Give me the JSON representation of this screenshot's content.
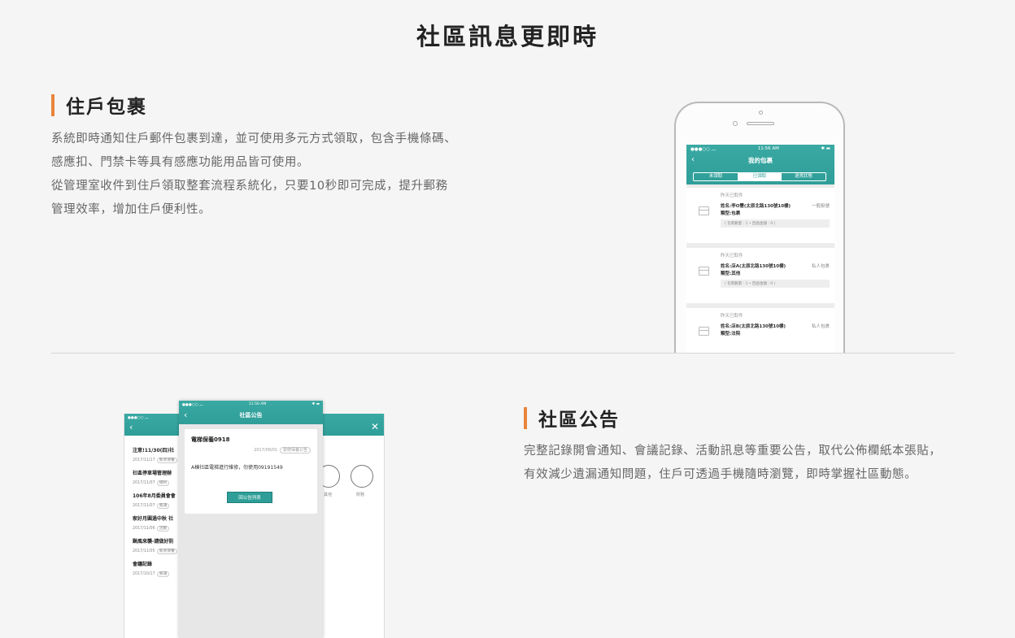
{
  "page_title": "社區訊息更即時",
  "section1": {
    "title": "住戶包裹",
    "paragraphs": [
      "系統即時通知住戶郵件包裹到達，並可使用多元方式領取，包含手機條碼、感應扣、門禁卡等具有感應功能用品皆可使用。",
      "從管理室收件到住戶領取整套流程系統化，只要10秒即可完成，提升郵務管理效率，增加住戶便利性。"
    ],
    "phone": {
      "status_time": "11:56 AM",
      "screen_title": "我的包裹",
      "tabs": [
        "未領取",
        "已領取",
        "退貨狀態"
      ],
      "cards": [
        {
          "when": "昨天已取件",
          "name": "姓名:李O豐(太原北路130號10樓)",
          "tag": "一般掛號",
          "type": "類型:包裹",
          "meta": "( 包裹數量 : 1 • 回函金額 : 0 )"
        },
        {
          "when": "昨天已取件",
          "name": "姓名:店A(太原北路130號10樓)",
          "tag": "私人包裹",
          "type": "類型:其他",
          "meta": "( 包裹數量 : 1 • 回函金額 : 0 )"
        },
        {
          "when": "昨天已取件",
          "name": "姓名:店B(太原北路130號10樓)",
          "tag": "私人包裹",
          "type": "類型:法院",
          "meta": ""
        }
      ]
    }
  },
  "section2": {
    "title": "社區公告",
    "paragraphs": [
      "完整記錄開會通知、會議記錄、活動訊息等重要公告，取代公佈欄紙本張貼，有效減少遺漏通知問題，住戶可透過手機隨時瀏覽，即時掌握社區動態。"
    ],
    "list_items": [
      {
        "title": "注意!11/30(四)社",
        "date": "2017/11/17",
        "tag": "緊修保養"
      },
      {
        "title": "社區停車場管理辦",
        "date": "2017/11/07",
        "tag": "規約"
      },
      {
        "title": "106年8月委員會會",
        "date": "2017/11/07",
        "tag": "會議"
      },
      {
        "title": "家好月圓過中秋 社",
        "date": "2017/11/06",
        "tag": "活動"
      },
      {
        "title": "颱風來襲-請做好防",
        "date": "2017/11/05",
        "tag": "緊修保養"
      },
      {
        "title": "會議記錄",
        "date": "2017/10/17",
        "tag": "會議"
      }
    ],
    "front": {
      "status_time": "11:56 AM",
      "screen_title": "社區公告",
      "ann_title": "電梯保養0918",
      "ann_date": "2017/09/01",
      "ann_tag": "緊修保養公告",
      "ann_body": "A棟社區電梯進行維修，勿使用09191549",
      "ann_button": "回公告列表"
    },
    "right_icons": [
      "其他",
      "財務"
    ]
  }
}
